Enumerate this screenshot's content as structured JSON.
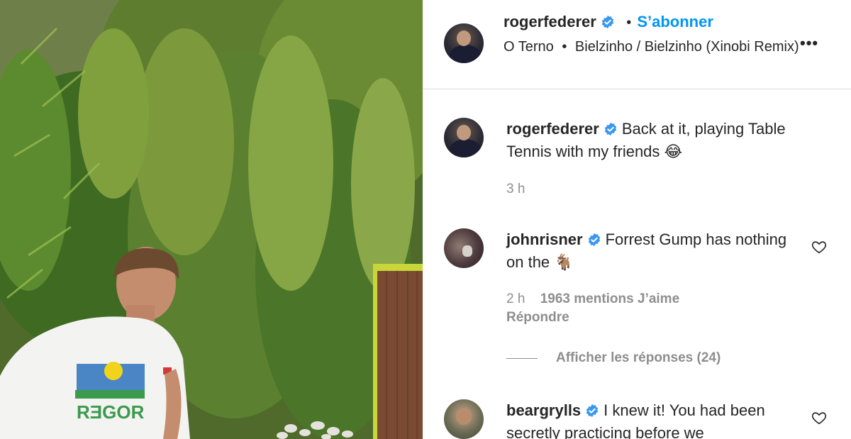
{
  "post": {
    "author": "rogerfederer",
    "follow_label": "S’abonner",
    "separator": "•",
    "music_artist": "O Terno",
    "music_track": "Bielzinho / Bielzinho (Xinobi Remix)",
    "more_label": "•••"
  },
  "caption": {
    "username": "rogerfederer",
    "text": "Back at it, playing Table Tennis with my friends 😂",
    "time": "3 h"
  },
  "comments": [
    {
      "username": "johnrisner",
      "text": "Forrest Gump has nothing on the 🐐",
      "time": "2 h",
      "likes": "1963 mentions J’aime",
      "reply_label": "Répondre",
      "view_replies": "Afficher les réponses (24)"
    },
    {
      "username": "beargrylls",
      "text": "I knew it! You had been secretly practicing before we"
    }
  ],
  "media": {
    "shirt_text": "RƎGOR"
  },
  "icons": {
    "verified": "verified-badge-icon",
    "like": "heart-icon",
    "more": "more-options-icon"
  },
  "colors": {
    "accent": "#0095f6",
    "verified": "#3897f0",
    "muted": "#8e8e8e",
    "text": "#262626"
  }
}
